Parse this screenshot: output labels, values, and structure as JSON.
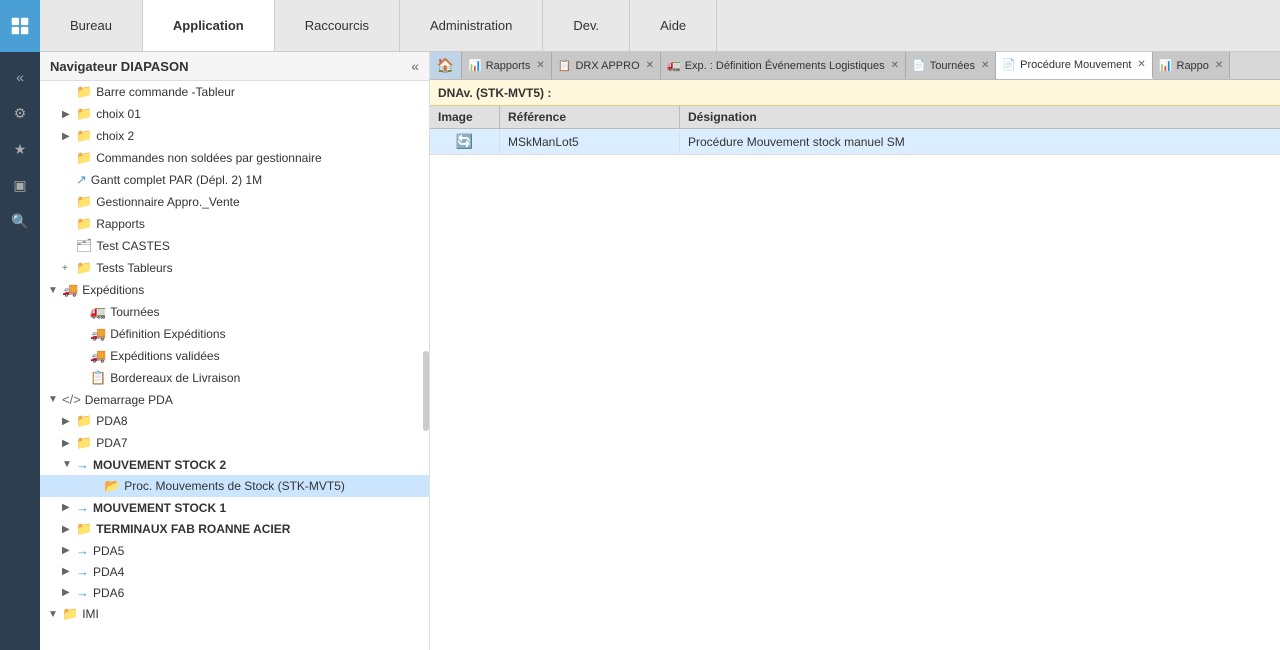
{
  "topbar": {
    "menu": [
      {
        "label": "Bureau",
        "active": false
      },
      {
        "label": "Application",
        "active": true
      },
      {
        "label": "Raccourcis",
        "active": false
      },
      {
        "label": "Administration",
        "active": false
      },
      {
        "label": "Dev.",
        "active": false
      },
      {
        "label": "Aide",
        "active": false
      }
    ]
  },
  "sidebar": {
    "title": "Navigateur DIAPASON",
    "items": [
      {
        "id": "barre-commande",
        "label": "Barre commande -Tableur",
        "indent": 2,
        "icon": "folder",
        "chevron": ""
      },
      {
        "id": "choix01",
        "label": "choix 01",
        "indent": 2,
        "icon": "folder",
        "chevron": "▶"
      },
      {
        "id": "choix02",
        "label": "choix 2",
        "indent": 2,
        "icon": "folder",
        "chevron": "▶"
      },
      {
        "id": "commandes",
        "label": "Commandes non soldées par gestionnaire",
        "indent": 2,
        "icon": "doc",
        "chevron": ""
      },
      {
        "id": "gantt",
        "label": "Gantt complet PAR (Dépl. 2) 1M",
        "indent": 2,
        "icon": "arrow",
        "chevron": ""
      },
      {
        "id": "gestionnaire",
        "label": "Gestionnaire Appro._Vente",
        "indent": 2,
        "icon": "folder",
        "chevron": ""
      },
      {
        "id": "rapports",
        "label": "Rapports",
        "indent": 2,
        "icon": "folder",
        "chevron": ""
      },
      {
        "id": "test-castes",
        "label": "Test CASTES",
        "indent": 2,
        "icon": "folder-special",
        "chevron": ""
      },
      {
        "id": "tests-tableurs",
        "label": "Tests Tableurs",
        "indent": 2,
        "icon": "plus",
        "chevron": ""
      },
      {
        "id": "expeditions",
        "label": "Expéditions",
        "indent": 1,
        "icon": "truck",
        "chevron": "▼",
        "expanded": true
      },
      {
        "id": "tournees",
        "label": "Tournées",
        "indent": 3,
        "icon": "truck-small",
        "chevron": ""
      },
      {
        "id": "def-expeditions",
        "label": "Définition Expéditions",
        "indent": 3,
        "icon": "truck-arrow",
        "chevron": ""
      },
      {
        "id": "expeditions-validees",
        "label": "Expéditions validées",
        "indent": 3,
        "icon": "truck-check",
        "chevron": ""
      },
      {
        "id": "bordereaux",
        "label": "Bordereaux de Livraison",
        "indent": 3,
        "icon": "truck-doc",
        "chevron": ""
      },
      {
        "id": "demarrage-pda",
        "label": "Demarrage PDA",
        "indent": 1,
        "icon": "code",
        "chevron": "▼",
        "expanded": true
      },
      {
        "id": "pda8",
        "label": "PDA8",
        "indent": 2,
        "icon": "folder",
        "chevron": "▶"
      },
      {
        "id": "pda7",
        "label": "PDA7",
        "indent": 2,
        "icon": "folder",
        "chevron": "▶"
      },
      {
        "id": "mvt-stock2",
        "label": "MOUVEMENT STOCK 2",
        "indent": 2,
        "icon": "arrow-right",
        "chevron": "▼",
        "expanded": true
      },
      {
        "id": "proc-mvt-stock",
        "label": "Proc. Mouvements de Stock (STK-MVT5)",
        "indent": 4,
        "icon": "folder-open",
        "chevron": ""
      },
      {
        "id": "mvt-stock1",
        "label": "MOUVEMENT STOCK 1",
        "indent": 2,
        "icon": "arrow-right",
        "chevron": "▶"
      },
      {
        "id": "terminaux",
        "label": "TERMINAUX FAB ROANNE ACIER",
        "indent": 2,
        "icon": "folder",
        "chevron": "▶"
      },
      {
        "id": "pda5",
        "label": "PDA5",
        "indent": 2,
        "icon": "arrow-right",
        "chevron": "▶"
      },
      {
        "id": "pda4",
        "label": "PDA4",
        "indent": 2,
        "icon": "arrow-right",
        "chevron": "▶"
      },
      {
        "id": "pda6",
        "label": "PDA6",
        "indent": 2,
        "icon": "arrow-right",
        "chevron": "▶"
      },
      {
        "id": "imi",
        "label": "IMI",
        "indent": 1,
        "icon": "folder",
        "chevron": "▼"
      }
    ]
  },
  "tabs": [
    {
      "id": "rapports",
      "label": "Rapports",
      "icon": "📊",
      "closable": true,
      "active": false
    },
    {
      "id": "drx-appro",
      "label": "DRX APPRO",
      "icon": "📋",
      "closable": true,
      "active": false
    },
    {
      "id": "exp-def",
      "label": "Exp. : Définition Événements Logistiques",
      "icon": "🚛",
      "closable": true,
      "active": false
    },
    {
      "id": "tournees",
      "label": "Tournées",
      "icon": "📄",
      "closable": true,
      "active": false
    },
    {
      "id": "proc-mvt",
      "label": "Procédure Mouvement",
      "icon": "📄",
      "closable": true,
      "active": true
    },
    {
      "id": "rappo",
      "label": "Rappo",
      "icon": "📊",
      "closable": true,
      "active": false
    }
  ],
  "dnav": {
    "label": "DNAv. (STK-MVT5) :"
  },
  "table": {
    "headers": [
      "Image",
      "Référence",
      "Désignation"
    ],
    "rows": [
      {
        "image": "🔄",
        "reference": "MSkManLot5",
        "designation": "Procédure Mouvement stock manuel SM"
      }
    ]
  },
  "icons": {
    "collapse": "«",
    "home": "🏠",
    "gear": "⚙",
    "star": "★",
    "monitor": "🖥",
    "search": "🔍"
  }
}
